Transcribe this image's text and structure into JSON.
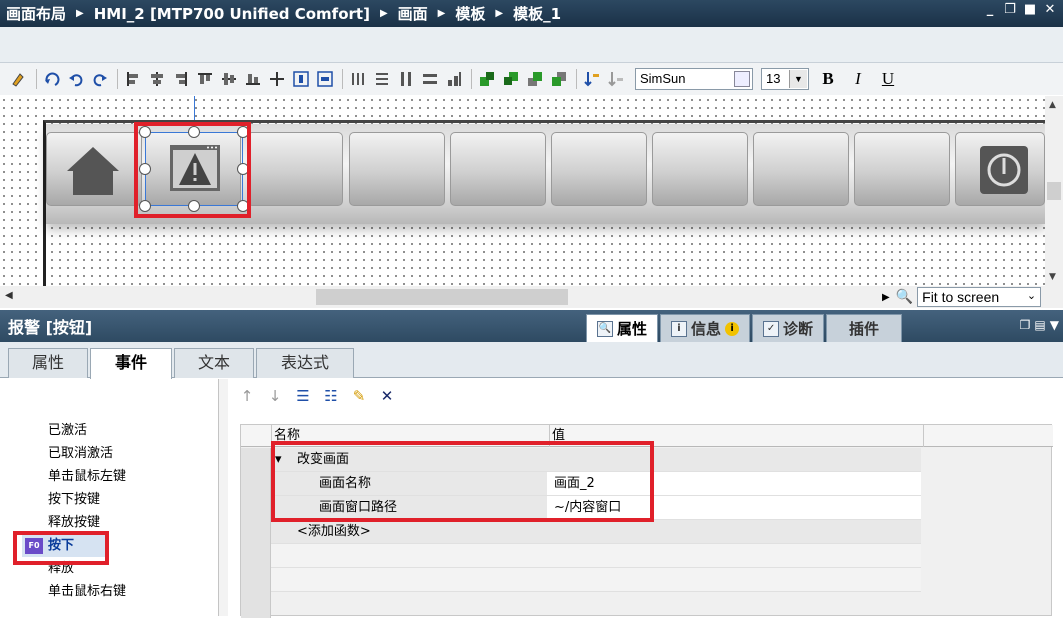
{
  "breadcrumb": [
    "画面布局",
    "HMI_2 [MTP700 Unified Comfort]",
    "画面",
    "模板",
    "模板_1"
  ],
  "toolbar": {
    "font_name": "SimSun",
    "font_size": "13",
    "bold_label": "B",
    "italic_label": "I",
    "underline_label": "U"
  },
  "zoom": {
    "value": "Fit to screen"
  },
  "inspector": {
    "title": "报警 [按钮]",
    "tabs": [
      {
        "label": "属性",
        "icon": "properties-icon",
        "active": true
      },
      {
        "label": "信息",
        "icon": "info-icon",
        "active": false
      },
      {
        "label": "诊断",
        "icon": "diagnostics-icon",
        "active": false
      },
      {
        "label": "插件",
        "icon": "",
        "active": false
      }
    ],
    "sub_tabs": [
      "属性",
      "事件",
      "文本",
      "表达式"
    ],
    "active_sub_tab": "事件"
  },
  "events": [
    "已激活",
    "已取消激活",
    "单击鼠标左键",
    "按下按键",
    "释放按键",
    "按下",
    "释放",
    "单击鼠标右键"
  ],
  "active_event": "按下",
  "grid": {
    "col_name": "名称",
    "col_value": "值",
    "function_name": "改变画面",
    "params": [
      {
        "name": "画面名称",
        "value": "画面_2"
      },
      {
        "name": "画面窗口路径",
        "value": "~/内容窗口"
      }
    ],
    "add_function": "<添加函数>"
  },
  "colors": {
    "title_bar": "#1e3a52",
    "highlight_red": "#e0202a",
    "selection_blue": "#3a78d6"
  }
}
